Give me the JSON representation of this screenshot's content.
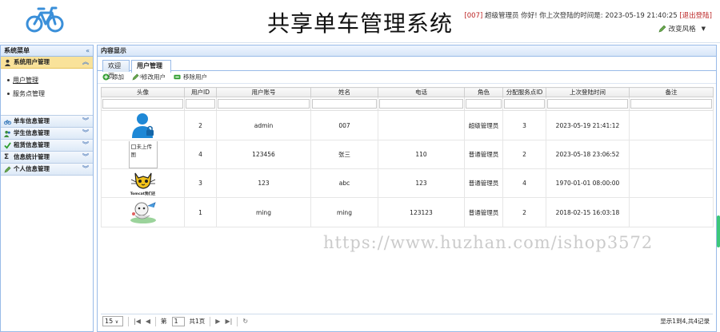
{
  "header": {
    "title": "共享单车管理系统",
    "user_prefix": "[007]",
    "user_text": " 超级管理员 你好! 你上次登陆的时间是: 2023-05-19 21:40:25",
    "logout": "[退出登陆]",
    "theme": "改变风格"
  },
  "sidebar": {
    "title": "系统菜单",
    "collapse": "«",
    "groups": [
      {
        "label": "系统用户管理",
        "icon": "user-icon",
        "open": true,
        "items": [
          "用户管理",
          "服务点管理"
        ]
      },
      {
        "label": "单车信息管理",
        "icon": "bike-icon"
      },
      {
        "label": "学生信息管理",
        "icon": "student-icon"
      },
      {
        "label": "租赁信息管理",
        "icon": "check-icon"
      },
      {
        "label": "信息统计管理",
        "icon": "sigma-icon"
      },
      {
        "label": "个人信息管理",
        "icon": "pencil-icon"
      }
    ]
  },
  "main": {
    "title": "内容显示",
    "tabs": [
      {
        "label": "欢迎页"
      },
      {
        "label": "用户管理",
        "close": "⊗"
      }
    ],
    "toolbar": {
      "add": "添加",
      "edit": "修改用户",
      "remove": "移除用户"
    }
  },
  "table": {
    "columns": [
      "头像",
      "用户ID",
      "用户账号",
      "姓名",
      "电话",
      "角色",
      "分配服务点ID",
      "上次登陆时间",
      "备注"
    ],
    "rows": [
      {
        "avatar": "silhouette",
        "id": "2",
        "account": "admin",
        "name": "007",
        "phone": "",
        "role": "超级管理员",
        "point": "3",
        "last_login": "2023-05-19 21:41:12",
        "note": ""
      },
      {
        "avatar": "broken",
        "avatar_alt": "未上传图",
        "id": "4",
        "account": "123456",
        "name": "张三",
        "phone": "110",
        "role": "普通管理员",
        "point": "2",
        "last_login": "2023-05-18 23:06:52",
        "note": ""
      },
      {
        "avatar": "tomcat",
        "avatar_caption": "Tomcat我们还",
        "id": "3",
        "account": "123",
        "name": "abc",
        "phone": "123",
        "role": "普通管理员",
        "point": "4",
        "last_login": "1970-01-01 08:00:00",
        "note": ""
      },
      {
        "avatar": "cartoon",
        "id": "1",
        "account": "ming",
        "name": "ming",
        "phone": "123123",
        "role": "普通管理员",
        "point": "2",
        "last_login": "2018-02-15 16:03:18",
        "note": ""
      }
    ]
  },
  "pager": {
    "page_size": "15",
    "page_label_pre": "第",
    "page_value": "1",
    "page_label_post": "共1页",
    "info": "显示1到4,共4记录"
  },
  "watermark": "https://www.huzhan.com/ishop3572",
  "colors": {
    "accent": "#3a8fd9",
    "header_border": "#99bbe8",
    "open_group": "#f9e29a"
  }
}
